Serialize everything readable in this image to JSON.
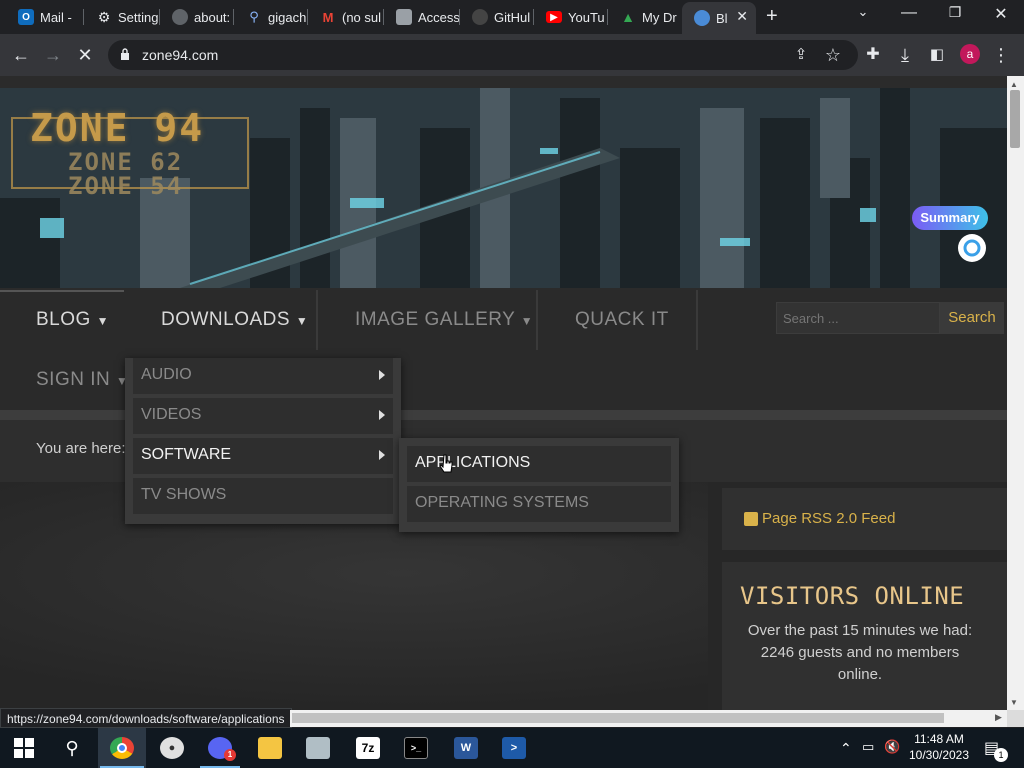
{
  "browser": {
    "tabs": [
      {
        "title": "Mail -",
        "icon": "outlook-icon",
        "color": "#0f6cbd"
      },
      {
        "title": "Setting",
        "icon": "settings-icon",
        "color": "#5f6368"
      },
      {
        "title": "about:",
        "icon": "globe-icon",
        "color": "#5f6368"
      },
      {
        "title": "gigach",
        "icon": "search-icon",
        "color": "#8ab4f8"
      },
      {
        "title": "(no sul",
        "icon": "gmail-icon",
        "color": "#ea4335"
      },
      {
        "title": "Access",
        "icon": "access-icon",
        "color": "#9aa0a6"
      },
      {
        "title": "GitHul",
        "icon": "github-icon",
        "color": "#333333"
      },
      {
        "title": "YouTu",
        "icon": "youtube-icon",
        "color": "#ff0000"
      },
      {
        "title": "My Dr",
        "icon": "drive-icon",
        "color": "#34a853"
      },
      {
        "title": "Bl",
        "icon": "site-icon",
        "color": "#4a8bd6"
      }
    ],
    "url": "zone94.com",
    "avatar_letter": "a",
    "status_url": "https://zone94.com/downloads/software/applications"
  },
  "site": {
    "logo": {
      "line1": "ZONE 94",
      "line2": "ZONE 62",
      "line3": "ZONE 54"
    },
    "summary_button": "Summary",
    "nav": {
      "blog": "BLOG",
      "downloads": "DOWNLOADS",
      "image_gallery": "IMAGE GALLERY",
      "quack_it": "QUACK IT",
      "sign_in": "SIGN IN"
    },
    "search": {
      "placeholder": "Search ...",
      "button": "Search"
    },
    "breadcrumb_label": "You are here:",
    "downloads_menu": [
      {
        "label": "AUDIO",
        "has_submenu": true
      },
      {
        "label": "VIDEOS",
        "has_submenu": true
      },
      {
        "label": "SOFTWARE",
        "has_submenu": true,
        "highlighted": true
      },
      {
        "label": "TV SHOWS",
        "has_submenu": false
      }
    ],
    "software_menu": [
      {
        "label": "APPLICATIONS",
        "highlighted": true
      },
      {
        "label": "OPERATING SYSTEMS",
        "highlighted": false
      }
    ],
    "rss_label": "Page RSS 2.0 Feed",
    "visitors": {
      "title": "VISITORS ONLINE",
      "text": "Over the past 15 minutes we had: 2246 guests and no members online."
    }
  },
  "taskbar": {
    "time": "11:48 AM",
    "date": "10/30/2023",
    "notification_count": "1",
    "apps": [
      "windows-start-icon",
      "search-icon",
      "chrome-icon",
      "media-player-icon",
      "discord-icon",
      "file-explorer-icon",
      "notepad-icon",
      "7zip-icon",
      "terminal-icon",
      "word-icon",
      "powershell-icon"
    ]
  },
  "colors": {
    "accent_gold": "#d9b24a",
    "page_bg": "#2b2b2b",
    "chrome_dark": "#202124"
  }
}
